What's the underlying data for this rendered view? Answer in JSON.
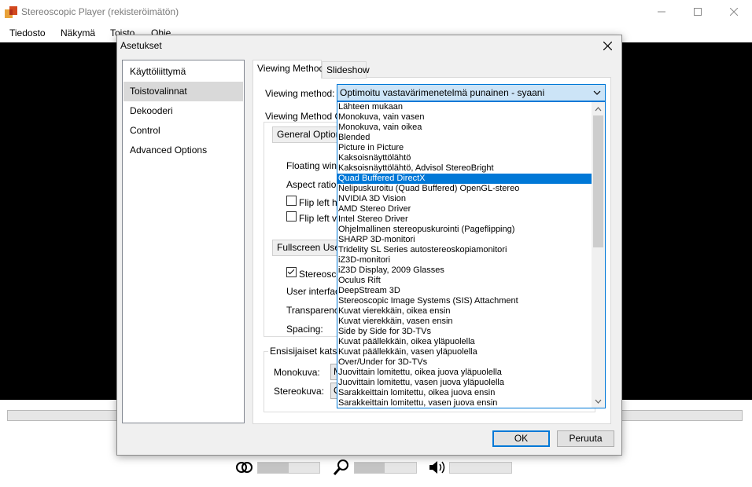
{
  "window": {
    "title": "Stereoscopic Player (rekisteröimätön)",
    "icon": "stereoscopic-player-logo",
    "menu": [
      "Tiedosto",
      "Näkymä",
      "Toisto",
      "Ohje"
    ]
  },
  "dialog": {
    "title": "Asetukset",
    "nav": [
      {
        "label": "Käyttöliittymä",
        "selected": false
      },
      {
        "label": "Toistovalinnat",
        "selected": true
      },
      {
        "label": "Dekooderi",
        "selected": false
      },
      {
        "label": "Control",
        "selected": false
      },
      {
        "label": "Advanced Options",
        "selected": false
      }
    ],
    "tabs": [
      {
        "label": "Viewing Method",
        "active": true
      },
      {
        "label": "Slideshow",
        "active": false
      }
    ],
    "viewing_method_label": "Viewing method:",
    "viewing_method_value": "Optimoitu vastavärimenetelmä punainen - syaani",
    "options_group_label": "Viewing Method Op",
    "general_options_button": "General Options",
    "floating_window_label": "Floating wind",
    "aspect_ratio_label": "Aspect ratio:",
    "flip_left_horizontal_label": "Flip left ho",
    "flip_left_horizontal_checked": false,
    "flip_left_vertical_label": "Flip left ve",
    "flip_left_vertical_checked": false,
    "fullscreen_user_button": "Fullscreen User",
    "stereoscopic_label": "Stereosco",
    "stereoscopic_checked": true,
    "user_interface_label": "User interfac",
    "transparency_label": "Transparency",
    "spacing_label": "Spacing:",
    "preferred_group_label": "Ensisijaiset katselu",
    "mono_label": "Monokuva:",
    "mono_value": "M",
    "stereo_label": "Stereokuva:",
    "stereo_value": "O",
    "ok_button": "OK",
    "cancel_button": "Peruuta"
  },
  "dropdown": {
    "selected_index": 7,
    "items": [
      "Lähteen mukaan",
      "Monokuva, vain vasen",
      "Monokuva, vain oikea",
      "Blended",
      "Picture in Picture",
      "Kaksoisnäyttölähtö",
      "Kaksoisnäyttölähtö, Advisol StereoBright",
      "Quad Buffered DirectX",
      "Nelipuskuroitu (Quad Buffered) OpenGL-stereo",
      "NVIDIA 3D Vision",
      "AMD Stereo Driver",
      "Intel Stereo Driver",
      "Ohjelmallinen stereopuskurointi (Pageflipping)",
      "SHARP 3D-monitori",
      "Tridelity SL Series autostereoskopiamonitori",
      "iZ3D-monitori",
      "iZ3D Display, 2009 Glasses",
      "Oculus Rift",
      "DeepStream 3D",
      "Stereoscopic Image Systems (SIS) Attachment",
      "Kuvat vierekkäin, oikea ensin",
      "Kuvat vierekkäin, vasen ensin",
      "Side by Side for 3D-TVs",
      "Kuvat päällekkäin, oikea yläpuolella",
      "Kuvat päällekkäin, vasen yläpuolella",
      "Over/Under for 3D-TVs",
      "Juovittain lomitettu, oikea juova yläpuolella",
      "Juovittain lomitettu, vasen juova yläpuolella",
      "Sarakkeittain lomitettu, oikea juova ensin",
      "Sarakkeittain lomitettu, vasen juova ensin"
    ]
  },
  "controls": {
    "playback_progress": 0,
    "stereo_slider_fraction": 0.5,
    "zoom_slider_fraction": 0.49,
    "volume_slider_fraction": 0
  }
}
